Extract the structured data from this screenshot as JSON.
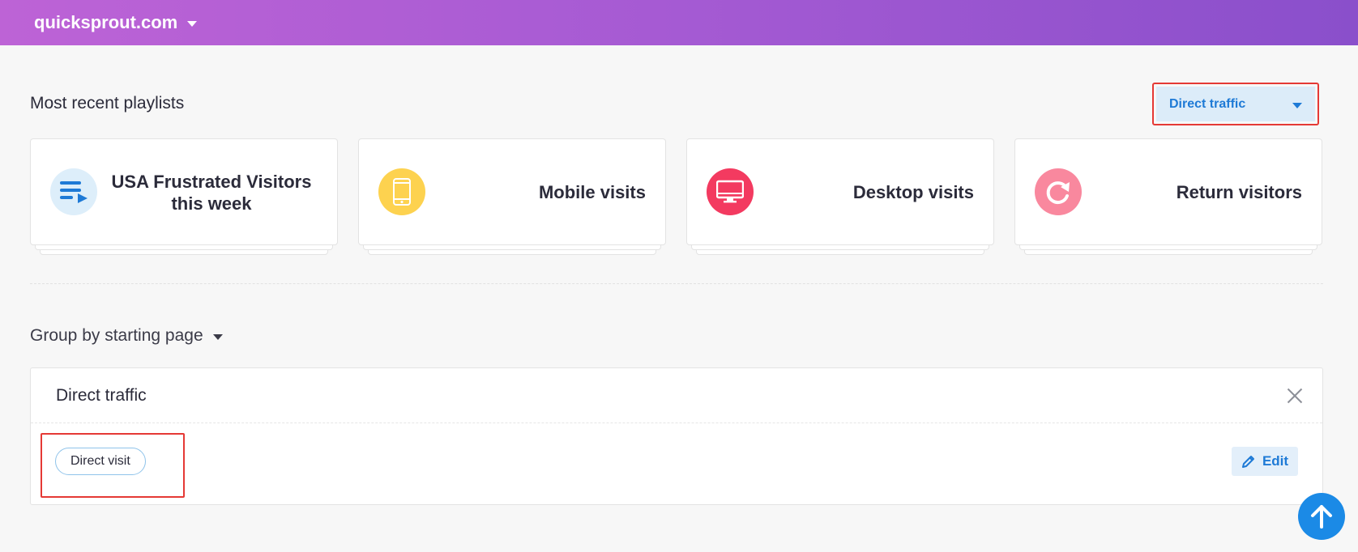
{
  "header": {
    "site_name": "quicksprout.com"
  },
  "recent": {
    "title": "Most recent playlists",
    "segment_selected": "Direct traffic",
    "cards": [
      {
        "label": "USA Frustrated Visitors this week",
        "icon": "playlist-icon",
        "color": "#ddeefa"
      },
      {
        "label": "Mobile visits",
        "icon": "mobile-phone-icon",
        "color": "#fdd24f"
      },
      {
        "label": "Desktop visits",
        "icon": "desktop-monitor-icon",
        "color": "#f33a60"
      },
      {
        "label": "Return visitors",
        "icon": "return-arrow-icon",
        "color": "#f9889e"
      }
    ]
  },
  "grouping": {
    "label": "Group by starting page"
  },
  "panel": {
    "title": "Direct traffic",
    "chip_label": "Direct visit",
    "edit_label": "Edit"
  },
  "colors": {
    "accent": "#1e7ad6",
    "highlight": "#e53935"
  }
}
